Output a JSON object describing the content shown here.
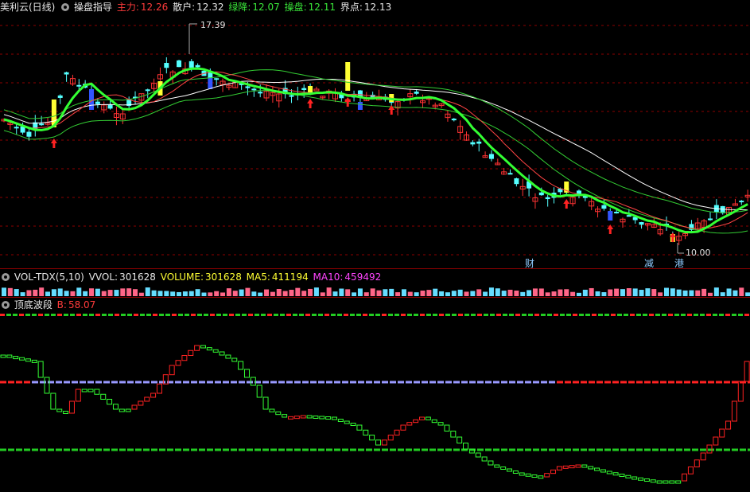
{
  "main_chart": {
    "title": "美利云(日线)",
    "indicator": "操盘指导",
    "zhuli_label": "主力:",
    "zhuli_value": "12.26",
    "sanhu_label": "散户:",
    "sanhu_value": "12.32",
    "lvjiang_label": "绿降:",
    "lvjiang_value": "12.07",
    "caopan_label": "操盘:",
    "caopan_value": "12.11",
    "jiedian_label": "界点:",
    "jiedian_value": "12.13",
    "high_price": "17.39",
    "low_price": "10.00",
    "events": [
      "财",
      "减",
      "港"
    ]
  },
  "volume_panel": {
    "name": "VOL-TDX(5,10)",
    "vvol_label": "VVOL:",
    "vvol_value": "301628",
    "volume_label": "VOLUME:",
    "volume_value": "301628",
    "ma5_label": "MA5:",
    "ma5_value": "411194",
    "ma10_label": "MA10:",
    "ma10_value": "459492"
  },
  "wave_panel": {
    "name": "顶底波段",
    "b_label": "B:",
    "b_value": "58.07"
  },
  "colors": {
    "up": "#ff3333",
    "down": "#54ffff",
    "green_line": "#33ff33",
    "grid": "#8b0000"
  }
}
